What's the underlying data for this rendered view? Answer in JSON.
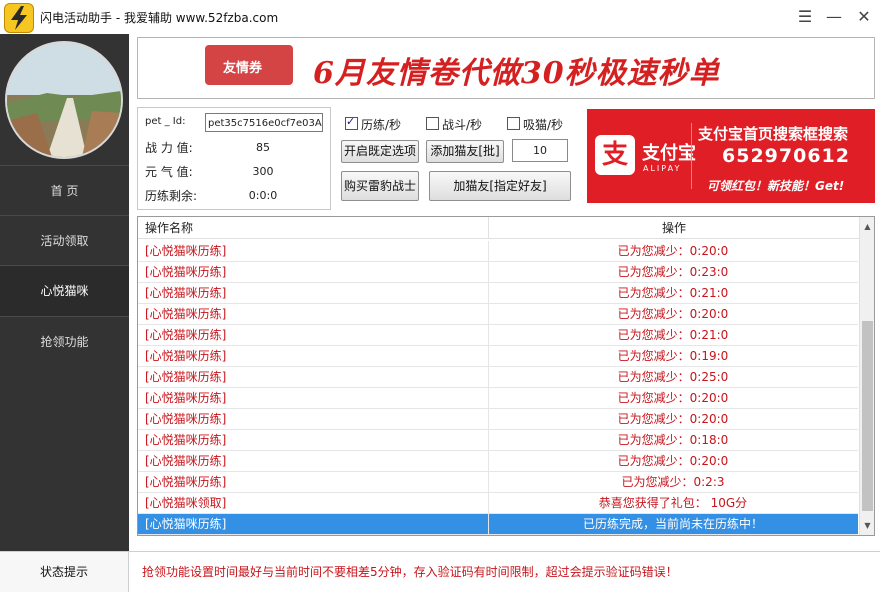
{
  "titlebar": {
    "title": "闪电活动助手 - 我爱辅助  www.52fzba.com",
    "minimize": "—",
    "close": "✕",
    "restore": "☰"
  },
  "sidebar": {
    "items": [
      {
        "label": "首    页",
        "active": false
      },
      {
        "label": "活动领取",
        "active": false
      },
      {
        "label": "心悦猫咪",
        "active": true
      },
      {
        "label": "抢领功能",
        "active": false
      }
    ]
  },
  "banner": {
    "ticket_label": "友情券",
    "text": "6月友情卷代做30秒极速秒单"
  },
  "info": {
    "pet_id_label": "pet _ Id:",
    "pet_id_value": "pet35c7516e0cf7e03A",
    "combat_label": "战 力 值:",
    "combat_value": "85",
    "energy_label": "元 气 值:",
    "energy_value": "300",
    "remaining_label": "历练剩余:",
    "remaining_value": "0:0:0"
  },
  "options": {
    "train_label": "历练/秒",
    "train_checked": true,
    "fight_label": "战斗/秒",
    "fight_checked": false,
    "absorb_label": "吸猫/秒",
    "absorb_checked": false,
    "preset_button": "开启既定选项",
    "add_batch_button": "添加猫友[批]",
    "batch_count": "10",
    "buy_button": "购买雷豹战士",
    "add_friend_button": "加猫友[指定好友]"
  },
  "ad": {
    "logo_char": "支",
    "brand": "支付宝",
    "brand_en": "ALIPAY",
    "title": "支付宝首页搜索框搜索",
    "code": "652970612",
    "promo": "可领红包！新技能！Get!"
  },
  "table": {
    "headers": [
      "操作名称",
      "操作"
    ],
    "rows": [
      {
        "name": "[心悦猫咪历练]",
        "action": "已为您减少：0:20:0"
      },
      {
        "name": "[心悦猫咪历练]",
        "action": "已为您减少：0:23:0"
      },
      {
        "name": "[心悦猫咪历练]",
        "action": "已为您减少：0:21:0"
      },
      {
        "name": "[心悦猫咪历练]",
        "action": "已为您减少：0:20:0"
      },
      {
        "name": "[心悦猫咪历练]",
        "action": "已为您减少：0:21:0"
      },
      {
        "name": "[心悦猫咪历练]",
        "action": "已为您减少：0:19:0"
      },
      {
        "name": "[心悦猫咪历练]",
        "action": "已为您减少：0:25:0"
      },
      {
        "name": "[心悦猫咪历练]",
        "action": "已为您减少：0:20:0"
      },
      {
        "name": "[心悦猫咪历练]",
        "action": "已为您减少：0:20:0"
      },
      {
        "name": "[心悦猫咪历练]",
        "action": "已为您减少：0:18:0"
      },
      {
        "name": "[心悦猫咪历练]",
        "action": "已为您减少：0:20:0"
      },
      {
        "name": "[心悦猫咪历练]",
        "action": "已为您减少：0:2:3"
      },
      {
        "name": "[心悦猫咪领取]",
        "action": "恭喜您获得了礼包： 10G分"
      },
      {
        "name": "[心悦猫咪历练]",
        "action": "已历练完成，当前尚未在历练中！",
        "selected": true
      }
    ]
  },
  "status": {
    "label": "状态提示",
    "message": "抢领功能设置时间最好与当前时间不要相差5分钟，存入验证码有时间限制，超过会提示验证码错误！"
  },
  "colors": {
    "sidebar_bg": "#333333",
    "accent_red": "#c8141b",
    "alipay_red": "#e01e26",
    "selection_blue": "#3390e4"
  }
}
